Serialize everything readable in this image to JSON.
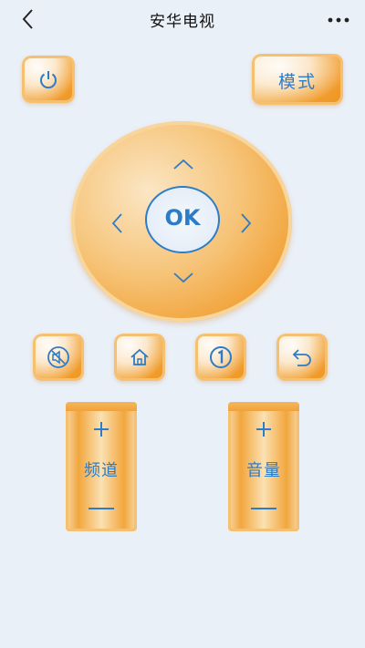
{
  "header": {
    "title": "安华电视",
    "back_icon": "chevron-left-icon",
    "more_icon": "more-dots-icon"
  },
  "remote": {
    "power_icon": "power-icon",
    "mode_label": "模式",
    "ok_label": "OK",
    "function_buttons": [
      "mute-icon",
      "home-icon",
      "number-one-icon",
      "return-icon"
    ],
    "channel": {
      "label": "频道",
      "up_icon": "plus-icon",
      "down_icon": "minus-icon"
    },
    "volume": {
      "label": "音量",
      "up_icon": "plus-icon",
      "down_icon": "minus-icon"
    }
  },
  "colors": {
    "accent_blue": "#2d7cc7",
    "button_orange": "#f2a63d",
    "background": "#eaf0f8"
  }
}
